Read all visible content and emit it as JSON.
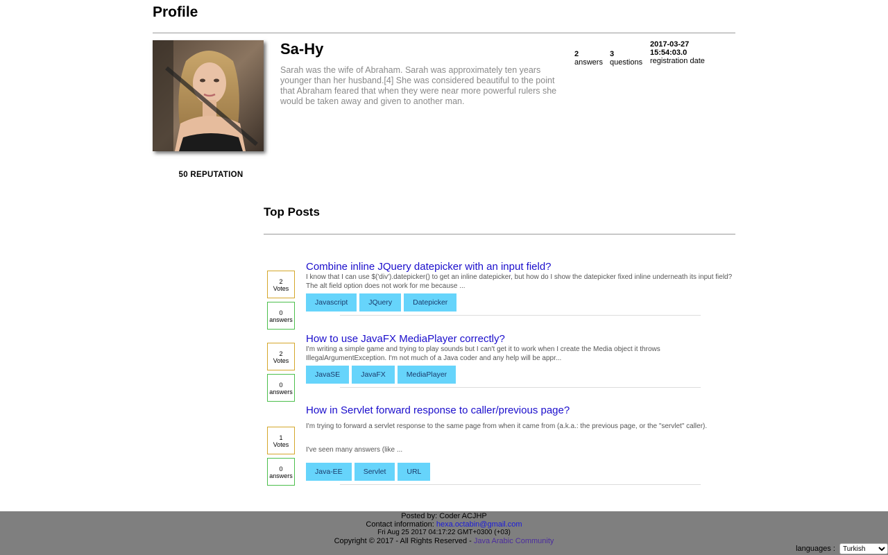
{
  "header": {
    "title": "Profile"
  },
  "profile": {
    "username": "Sa-Hy",
    "bio": "Sarah was the wife of Abraham. Sarah was approximately ten years younger than her husband.[4] She was considered beautiful to the point that Abraham feared that when they were near more powerful rulers she would be taken away and given to another man.",
    "answers_count": "2",
    "answers_label": "answers",
    "questions_count": "3",
    "questions_label": "questions",
    "registration_date": "2017-03-27 15:54:03.0",
    "registration_label": "registration date",
    "reputation": "50 REPUTATION"
  },
  "top_posts": {
    "title": "Top Posts",
    "posts": [
      {
        "votes": "2",
        "votes_label": "Votes",
        "answers": "0",
        "answers_label": "answers",
        "title": "Combine inline JQuery datepicker with an input field?",
        "excerpt": "I know that I can use $('div').datepicker() to get an inline datepicker, but how do I show the datepicker fixed inline underneath its input field? The alt field option does not work for me because ...",
        "excerpt2": "",
        "tags": [
          "Javascript",
          "JQuery",
          "Datepicker"
        ]
      },
      {
        "votes": "2",
        "votes_label": "Votes",
        "answers": "0",
        "answers_label": "answers",
        "title": "How to use JavaFX MediaPlayer correctly?",
        "excerpt": "I'm writing a simple game and trying to play sounds but I can't get it to work when I create the Media object it throws IllegalArgumentException. I'm not much of a Java coder and any help will be appr...",
        "excerpt2": "",
        "tags": [
          "JavaSE",
          "JavaFX",
          "MediaPlayer"
        ]
      },
      {
        "votes": "1",
        "votes_label": "Votes",
        "answers": "0",
        "answers_label": "answers",
        "title": "How in Servlet forward response to caller/previous page?",
        "excerpt": "I'm trying to forward a servlet response to the same page from when it came from (a.k.a.: the previous page, or the \"servlet\" caller).",
        "excerpt2": "I've seen many answers (like ...",
        "tags": [
          "Java-EE",
          "Servlet",
          "URL"
        ]
      }
    ]
  },
  "footer": {
    "posted_by": "Posted by: Coder ACJHP",
    "contact_label": "Contact information:",
    "contact_email": "hexa.octabin@gmail.com",
    "datetime": "Fri Aug 25 2017 04:17:22 GMT+0300 (+03)",
    "copyright": "Copyright © 2017 - All Rights Reserved -",
    "community_link": "Java Arabic Community",
    "languages_label": "languages :",
    "language_selected": "Turkish"
  }
}
